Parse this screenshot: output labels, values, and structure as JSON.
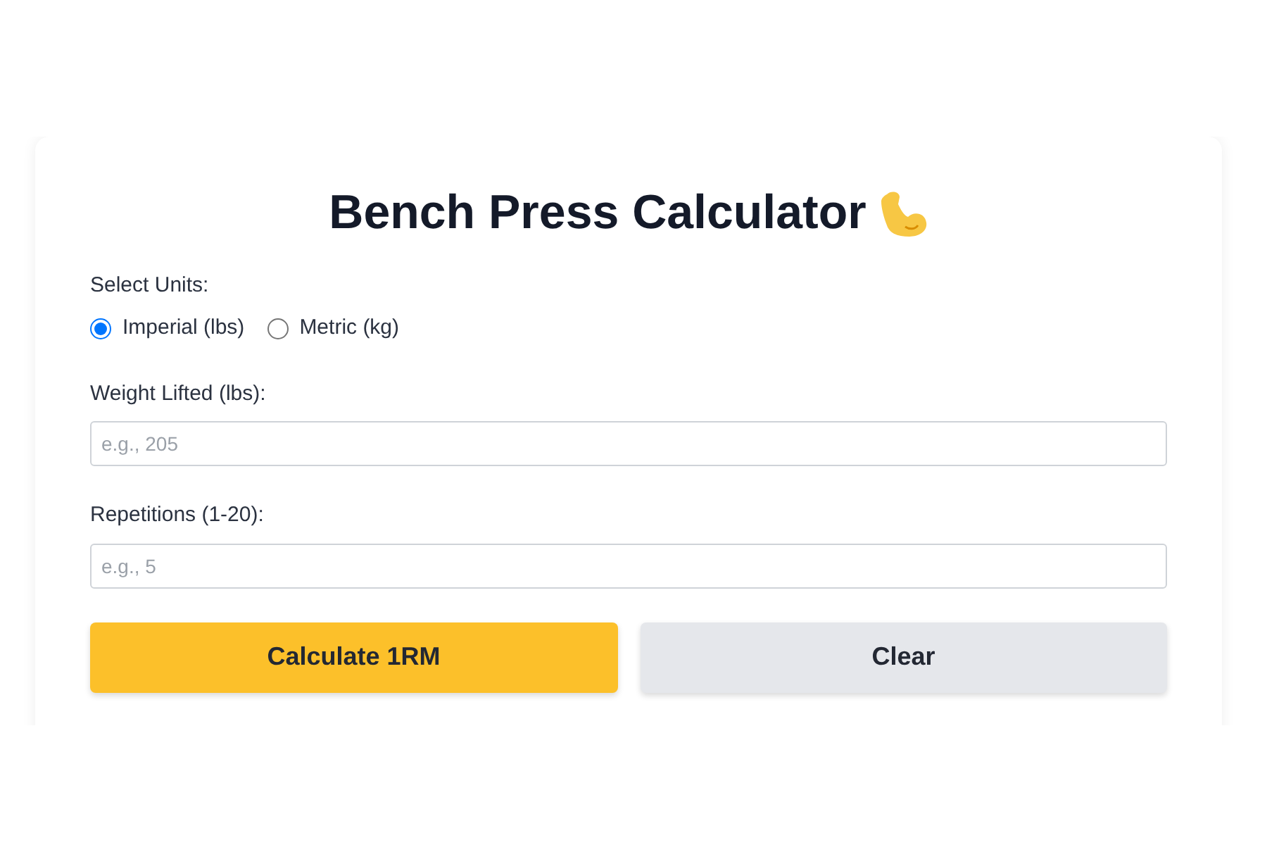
{
  "title": "Bench Press Calculator",
  "units": {
    "label": "Select Units:",
    "options": [
      {
        "label": "Imperial (lbs)",
        "selected": true
      },
      {
        "label": "Metric (kg)",
        "selected": false
      }
    ]
  },
  "fields": [
    {
      "label": "Weight Lifted (lbs):",
      "placeholder": "e.g., 205"
    },
    {
      "label": "Repetitions (1-20):",
      "placeholder": "e.g., 5"
    }
  ],
  "buttons": [
    {
      "label": "Calculate 1RM",
      "kind": "primary"
    },
    {
      "label": "Clear",
      "kind": "secondary"
    }
  ]
}
